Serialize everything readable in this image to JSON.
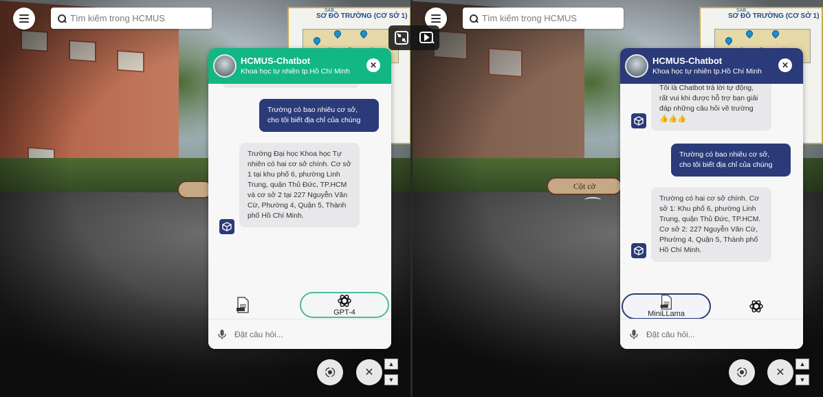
{
  "search": {
    "placeholder": "Tìm kiếm trong HCMUS"
  },
  "map_thumb": {
    "title": "SƠ ĐỒ TRƯỜNG (CƠ SỞ 1)",
    "badge": "SAB",
    "letters": [
      "C",
      "B",
      "A"
    ]
  },
  "hotspot": {
    "label": "Cột cờ"
  },
  "chatbot": {
    "title": "HCMUS-Chatbot",
    "subtitle": "Khoa học tự nhiên tp.Hồ Chí Minh"
  },
  "left": {
    "user_message": "Trường có bao nhiêu cơ sở, cho tôi biết địa chỉ của chúng",
    "bot_message": "Trường Đại học Khoa học Tự nhiên có hai cơ sở chính. Cơ sở 1 tại khu phố 6, phường Linh Trung, quận Thủ Đức, TP.HCM và cơ sở 2 tại 227 Nguyễn Văn Cừ, Phường 4, Quận 5, Thành phố Hồ Chí Minh.",
    "model_label": "GPT-4"
  },
  "right": {
    "bot_greeting": "Tôi là Chatbot trả lời tự động, rất vui khi được hỗ trợ bạn giải đáp những câu hỏi về trường 👍👍👍",
    "user_message": "Trường có bao nhiêu cơ sở, cho tôi biết địa chỉ của chúng",
    "bot_message": "Trường có hai cơ sở chính. Cơ sở 1: Khu phố 6, phường Linh Trung, quận Thủ Đức, TP.HCM. Cơ sở 2: 227 Nguyễn Văn Cừ, Phường 4, Quận 5, Thành phố Hồ Chí Minh.",
    "model_label": "MiniLLama"
  },
  "composer": {
    "placeholder": "Đặt câu hỏi..."
  },
  "controls": {
    "up": "▲",
    "down": "▼",
    "close": "✕"
  },
  "colors": {
    "gpt_header": "#12b783",
    "llama_header": "#2b3a78",
    "user_bubble": "#2b3a78",
    "bot_bubble": "#e8e8ea"
  },
  "icons": [
    "menu-icon",
    "search-icon",
    "close-icon",
    "chatbot-cube-icon",
    "document-icon",
    "openai-icon",
    "microphone-icon",
    "gyroscope-icon",
    "fullscreen-exit-icon",
    "video-icon"
  ]
}
